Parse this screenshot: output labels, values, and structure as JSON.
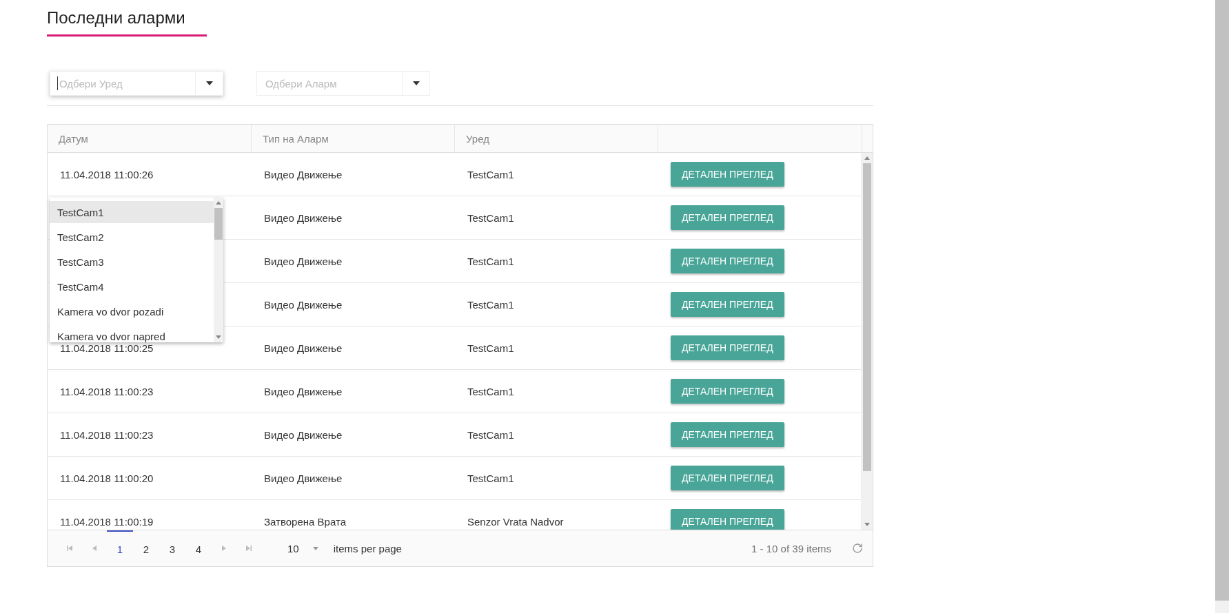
{
  "title": "Последни аларми",
  "filters": [
    {
      "placeholder": "Одбери Уред",
      "focused": true
    },
    {
      "placeholder": "Одбери Аларм",
      "focused": false
    }
  ],
  "table": {
    "columns": [
      "Датум",
      "Тип на Аларм",
      "Уред"
    ],
    "rows": [
      {
        "date": "11.04.2018 11:00:26",
        "type": "Видео Движење",
        "device": "TestCam1",
        "action": "ДЕТАЛЕН ПРЕГЛЕД"
      },
      {
        "type": "Видео Движење",
        "device": "TestCam1",
        "action": "ДЕТАЛЕН ПРЕГЛЕД"
      },
      {
        "type": "Видео Движење",
        "device": "TestCam1",
        "action": "ДЕТАЛЕН ПРЕГЛЕД"
      },
      {
        "type": "Видео Движење",
        "device": "TestCam1",
        "action": "ДЕТАЛЕН ПРЕГЛЕД"
      },
      {
        "date": "11.04.2018 11:00:25",
        "type": "Видео Движење",
        "device": "TestCam1",
        "action": "ДЕТАЛЕН ПРЕГЛЕД"
      },
      {
        "date": "11.04.2018 11:00:23",
        "type": "Видео Движење",
        "device": "TestCam1",
        "action": "ДЕТАЛЕН ПРЕГЛЕД"
      },
      {
        "date": "11.04.2018 11:00:23",
        "type": "Видео Движење",
        "device": "TestCam1",
        "action": "ДЕТАЛЕН ПРЕГЛЕД"
      },
      {
        "date": "11.04.2018 11:00:20",
        "type": "Видео Движење",
        "device": "TestCam1",
        "action": "ДЕТАЛЕН ПРЕГЛЕД"
      },
      {
        "date": "11.04.2018 11:00:19",
        "type": "Затворена Врата",
        "device": "Senzor Vrata Nadvor",
        "action": "ДЕТАЛЕН ПРЕГЛЕД"
      }
    ]
  },
  "device_list": {
    "items": [
      {
        "label": "TestCam1",
        "selected": true
      },
      {
        "label": "TestCam2",
        "selected": false
      },
      {
        "label": "TestCam3",
        "selected": false
      },
      {
        "label": "TestCam4",
        "selected": false
      },
      {
        "label": "Kamera vo dvor pozadi",
        "selected": false
      },
      {
        "label": "Kamera vo dvor napred",
        "selected": false
      }
    ]
  },
  "pager": {
    "pages": [
      {
        "label": "1",
        "selected": true
      },
      {
        "label": "2",
        "selected": false
      },
      {
        "label": "3",
        "selected": false
      },
      {
        "label": "4",
        "selected": false
      }
    ],
    "page_size": "10",
    "page_size_label": "items per page",
    "summary": "1 - 10 of 39 items"
  }
}
